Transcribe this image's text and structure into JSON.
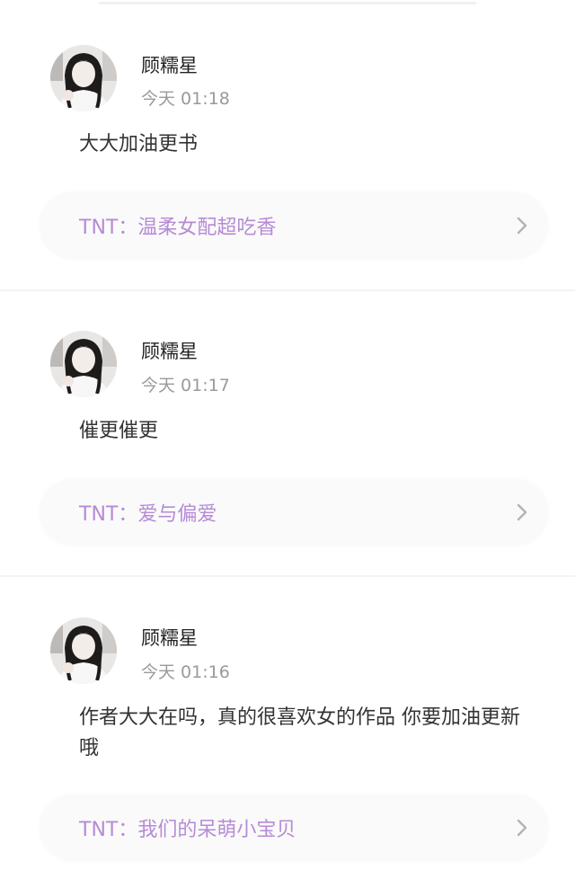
{
  "colors": {
    "accent": "#b68bd6",
    "username": "#222222",
    "time": "#9a9a9a",
    "content": "#333333",
    "pill_bg": "#fafafa"
  },
  "comments": [
    {
      "username": "顾糯星",
      "time": "今天 01:18",
      "content": "大大加油更书",
      "book_link": "TNT：温柔女配超吃香",
      "icon": "chevron-right-icon"
    },
    {
      "username": "顾糯星",
      "time": "今天 01:17",
      "content": "催更催更",
      "book_link": "TNT：爱与偏爱",
      "icon": "chevron-right-icon"
    },
    {
      "username": "顾糯星",
      "time": "今天 01:16",
      "content": "作者大大在吗，真的很喜欢女的作品 你要加油更新哦",
      "book_link": "TNT：我们的呆萌小宝贝",
      "icon": "chevron-right-icon"
    }
  ]
}
